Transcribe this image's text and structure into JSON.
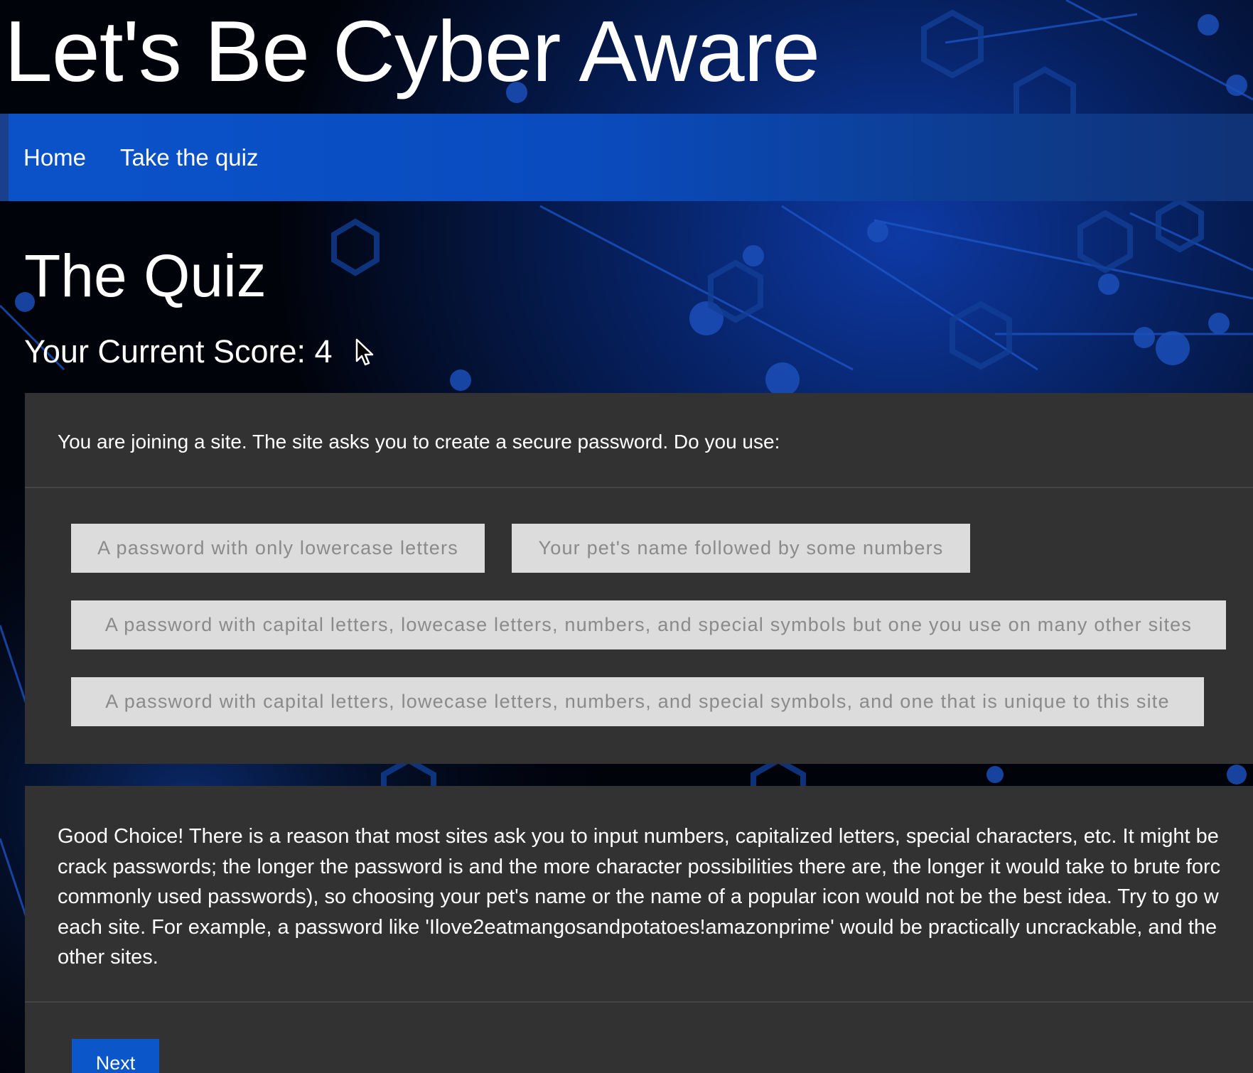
{
  "site": {
    "title": "Let's Be Cyber Aware"
  },
  "nav": {
    "items": [
      {
        "label": "Home"
      },
      {
        "label": "Take the quiz"
      }
    ]
  },
  "quiz": {
    "heading": "The Quiz",
    "score_label": "Your Current Score: 4",
    "question": "You are joining a site. The site asks you to create a secure password. Do you use:",
    "options": [
      {
        "label": "A password with only lowercase letters"
      },
      {
        "label": "Your pet's name followed by some numbers"
      },
      {
        "label": "A password with capital letters, lowecase letters, numbers, and special symbols but one you use on many other sites"
      },
      {
        "label": "A password with capital letters, lowecase letters, numbers, and special symbols, and one that is unique to this site"
      }
    ],
    "feedback_lines": [
      "Good Choice! There is a reason that most sites ask you to input numbers, capitalized letters, special characters, etc. It might be",
      "crack passwords; the longer the password is and the more character possibilities there are, the longer it would take to brute forc",
      "commonly used passwords), so choosing your pet's name or the name of a popular icon would not be the best idea. Try to go w",
      "each site. For example, a password like 'Ilove2eatmangosandpotatoes!amazonprime' would be practically uncrackable, and the",
      "other sites."
    ],
    "next_label": "Next"
  },
  "colors": {
    "navbar": "#0b52c9",
    "card_background": "#323232",
    "option_background": "#dcdcdc",
    "option_text": "#8a8a8a",
    "next_button": "#0b56c8"
  },
  "icons": {
    "pointer": "mouse-pointer-icon"
  }
}
